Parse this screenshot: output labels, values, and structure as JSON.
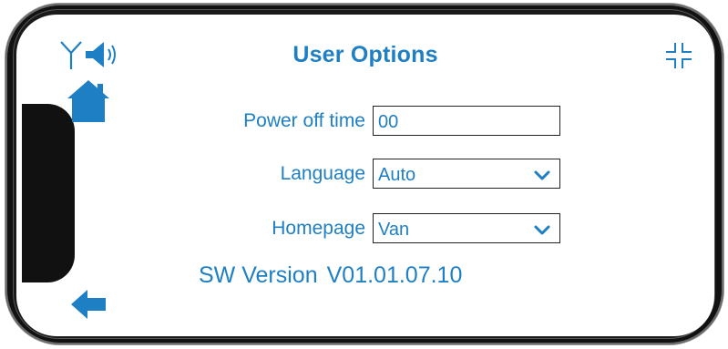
{
  "header": {
    "title": "User Options",
    "left_icons": [
      "antenna-icon",
      "speaker-icon"
    ],
    "right_icon": "exit-fullscreen-icon"
  },
  "nav": {
    "home_icon": "home-icon",
    "back_icon": "back-arrow-icon"
  },
  "form": {
    "power_off": {
      "label": "Power off time",
      "value": "00"
    },
    "language": {
      "label": "Language",
      "value": "Auto"
    },
    "homepage": {
      "label": "Homepage",
      "value": "Van"
    }
  },
  "version": {
    "label": "SW Version",
    "value": "V01.01.07.10"
  },
  "colors": {
    "accent": "#1e7fc4",
    "frame": "#111111"
  }
}
